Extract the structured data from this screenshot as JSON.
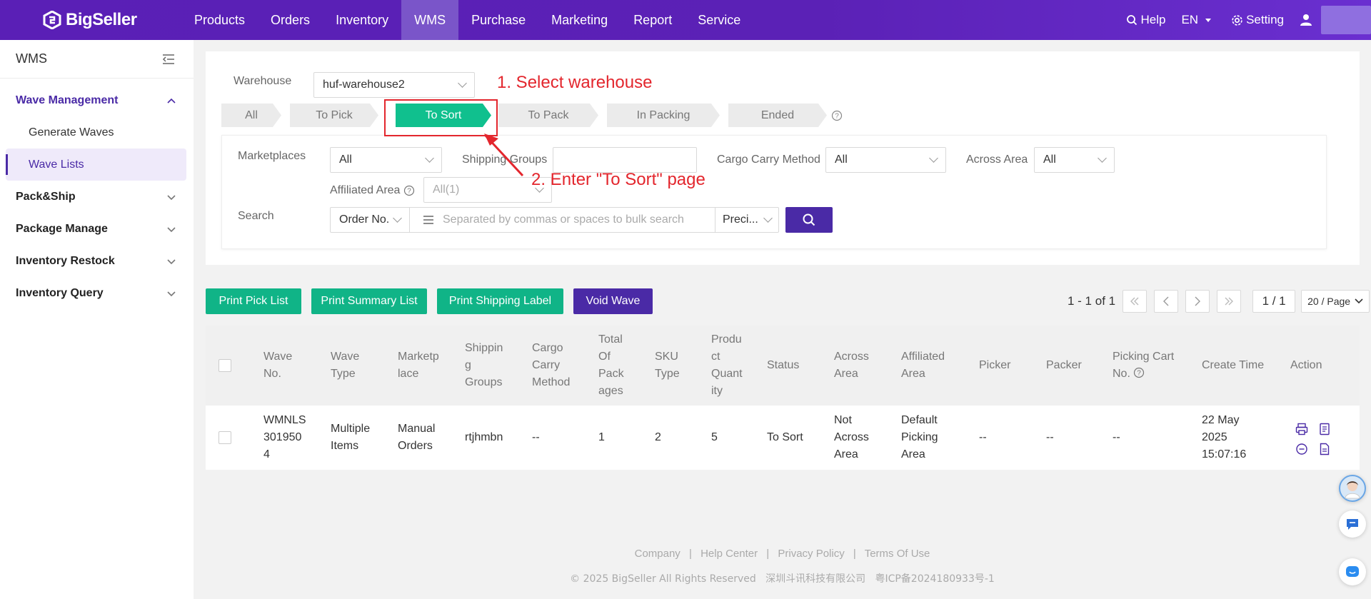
{
  "brand": {
    "name": "BigSeller"
  },
  "nav": {
    "items": [
      "Products",
      "Orders",
      "Inventory",
      "WMS",
      "Purchase",
      "Marketing",
      "Report",
      "Service"
    ],
    "active": "WMS"
  },
  "top_right": {
    "help": "Help",
    "lang": "EN",
    "setting": "Setting"
  },
  "sidebar": {
    "title": "WMS",
    "groups": [
      {
        "label": "Wave Management",
        "open": true,
        "items": [
          "Generate Waves",
          "Wave Lists"
        ]
      },
      {
        "label": "Pack&Ship"
      },
      {
        "label": "Package Manage"
      },
      {
        "label": "Inventory Restock"
      },
      {
        "label": "Inventory Query"
      }
    ],
    "active_item": "Wave Lists"
  },
  "filters": {
    "warehouse_label": "Warehouse",
    "warehouse_value": "huf-warehouse2",
    "steps": [
      "All",
      "To Pick",
      "To Sort",
      "To Pack",
      "In Packing",
      "Ended"
    ],
    "active_step": "To Sort",
    "marketplaces_label": "Marketplaces",
    "marketplaces_value": "All",
    "shipping_groups_label": "Shipping Groups",
    "cargo_label": "Cargo Carry Method",
    "cargo_value": "All",
    "across_label": "Across Area",
    "across_value": "All",
    "affiliated_label": "Affiliated Area",
    "affiliated_value": "All(1)",
    "search_label": "Search",
    "search_field": "Order No.",
    "search_placeholder": "Separated by commas or spaces to bulk search",
    "search_mode": "Preci..."
  },
  "annotations": {
    "step1": "1. Select warehouse",
    "step2": "2. Enter \"To Sort\" page",
    "color": "#e3262d"
  },
  "actions": {
    "print_pick": "Print Pick List",
    "print_summary": "Print Summary List",
    "print_shipping": "Print Shipping Label",
    "void_wave": "Void Wave"
  },
  "pagination": {
    "range": "1 - 1 of 1",
    "page": "1 / 1",
    "per_page": "20 / Page"
  },
  "table": {
    "headers": {
      "wave_no": "Wave No.",
      "wave_type": "Wave Type",
      "marketplace": "Marketp lace",
      "shipping_groups": "Shippin g Groups",
      "cargo": "Cargo Carry Method",
      "total_packages": "Total Of Pack ages",
      "sku_type": "SKU Type",
      "product_qty": "Produ ct Quant ity",
      "status": "Status",
      "across_area": "Across Area",
      "affiliated_area": "Affiliated Area",
      "picker": "Picker",
      "packer": "Packer",
      "picking_cart": "Picking Cart No.",
      "create_time": "Create Time",
      "action": "Action"
    },
    "rows": [
      {
        "wave_no": "WMNLS 301950 4",
        "wave_type": "Multiple Items",
        "marketplace": "Manual Orders",
        "shipping_groups": "rtjhmbn",
        "cargo": "--",
        "total_packages": "1",
        "sku_type": "2",
        "product_qty": "5",
        "status": "To Sort",
        "across_area": "Not Across Area",
        "affiliated_area": "Default Picking Area",
        "picker": "--",
        "packer": "--",
        "picking_cart": "--",
        "create_time": "22 May 2025 15:07:16"
      }
    ]
  },
  "footer": {
    "links": [
      "Company",
      "Help Center",
      "Privacy Policy",
      "Terms Of Use"
    ],
    "separator": "|",
    "copyright": "© 2025 BigSeller All Rights Reserved   深圳斗讯科技有限公司   粤ICP备2024180933号-1"
  },
  "colors": {
    "brand": "#5a1fb6",
    "accent": "#4a2aa6",
    "green": "#10b487"
  }
}
